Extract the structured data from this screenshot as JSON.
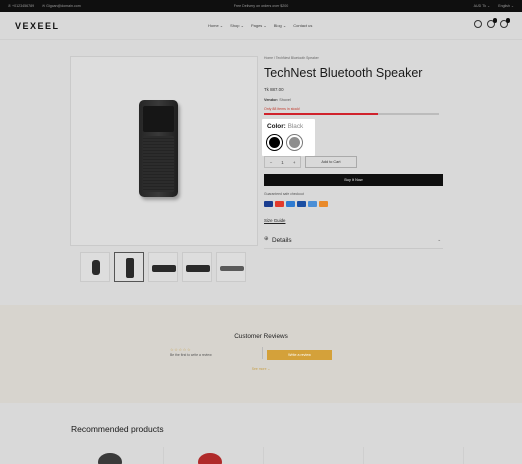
{
  "announcement": {
    "phone": "+0123456789",
    "email": "Gigcan@domain.com",
    "promo": "Free Delivery on orders over $200",
    "currency": "AUD Tk",
    "language": "English"
  },
  "header": {
    "logo": "VEXEEL",
    "nav": [
      {
        "label": "Home"
      },
      {
        "label": "Shop"
      },
      {
        "label": "Pages"
      },
      {
        "label": "Blog"
      },
      {
        "label": "Contact us"
      }
    ],
    "cart_count": "0",
    "wishlist_count": "0"
  },
  "product": {
    "breadcrumb": "Home  /  TechNest Bluetooth Speaker",
    "title": "TechNest Bluetooth Speaker",
    "price": "Tk 887.00",
    "vendor_label": "Vendor:",
    "vendor": "Shovel",
    "stock_text": "Only 88 items in stock!",
    "stock_fraction": 0.65,
    "color_label": "Color:",
    "color_value": "Black",
    "swatches": [
      {
        "name": "Black",
        "hex": "#000000"
      },
      {
        "name": "Grey",
        "hex": "#8e8e8e"
      }
    ],
    "quantity": "1",
    "add_to_cart": "Add to Cart",
    "buy_now": "Buy It Now",
    "guarantee": "Guaranteed safe checkout",
    "payments": [
      "visa",
      "mastercard",
      "amex",
      "paypal",
      "diners",
      "discover"
    ],
    "size_guide": "Size Guide",
    "details_label": "Details"
  },
  "reviews": {
    "title": "Customer Reviews",
    "stars": "☆☆☆☆☆",
    "first_text": "Be the first to write a review",
    "write_button": "Write a review",
    "see_more": "See more"
  },
  "recommended": {
    "title": "Recommended products"
  },
  "colors": {
    "accent": "#d4a13a",
    "stock_bar": "#d0222c",
    "buy_now_bg": "#0f0f0f"
  }
}
